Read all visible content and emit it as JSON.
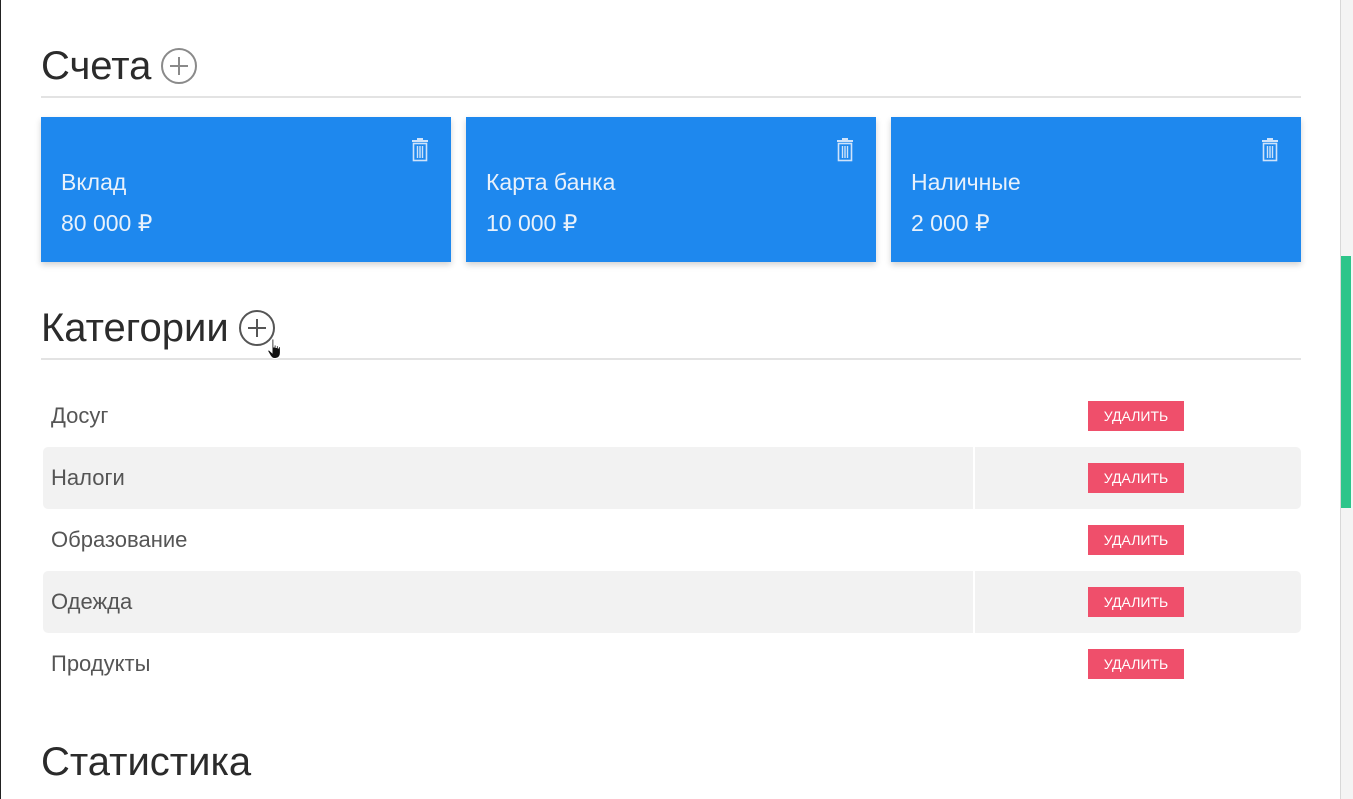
{
  "accounts": {
    "title": "Счета",
    "cards": [
      {
        "name": "Вклад",
        "amount": "80 000 ₽"
      },
      {
        "name": "Карта банка",
        "amount": "10 000 ₽"
      },
      {
        "name": "Наличные",
        "amount": "2 000 ₽"
      }
    ]
  },
  "categories": {
    "title": "Категории",
    "delete_label": "УДАЛИТЬ",
    "items": [
      "Досуг",
      "Налоги",
      "Образование",
      "Одежда",
      "Продукты"
    ]
  },
  "statistics": {
    "title": "Статистика"
  },
  "colors": {
    "card_bg": "#1e88ee",
    "delete_bg": "#ef4f6b",
    "scroll_thumb": "#2ec58a"
  },
  "icons": {
    "add": "plus-circle-icon",
    "delete_card": "trash-icon"
  }
}
